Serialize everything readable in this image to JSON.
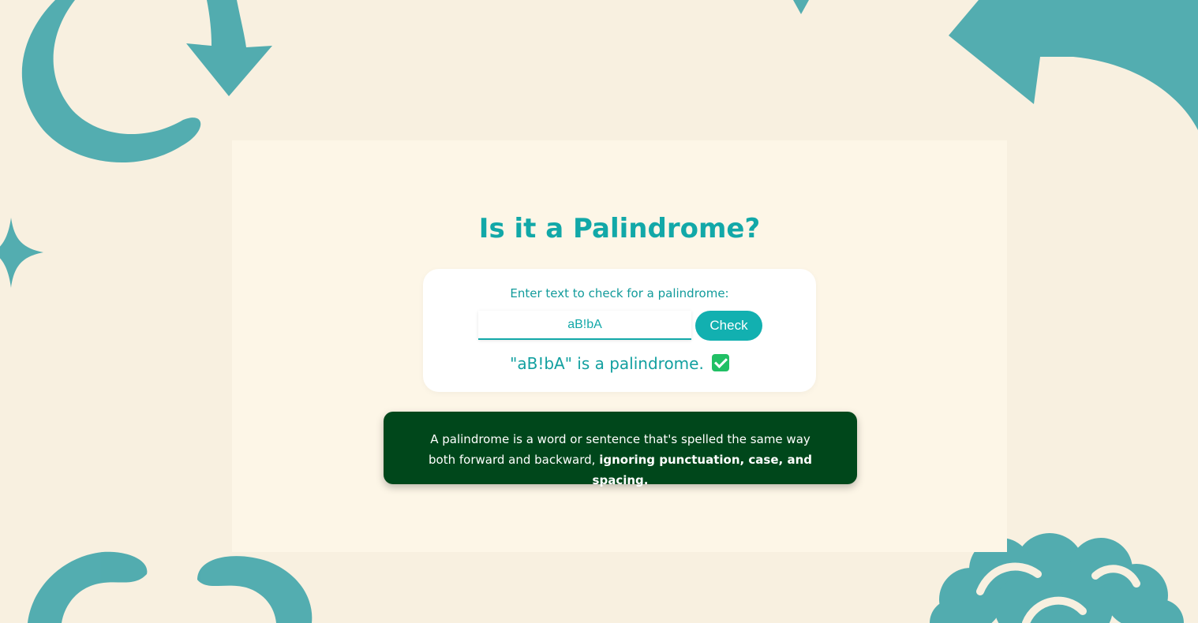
{
  "title": "Is it a Palindrome?",
  "input": {
    "label": "Enter text to check for a palindrome:",
    "value": "aB!bA"
  },
  "check_button": "Check",
  "result": {
    "text": "\"aB!bA\" is a palindrome.",
    "icon": "check-mark-icon"
  },
  "info": {
    "text": "A palindrome is a word or sentence that's spelled the same way both forward and backward, ",
    "emphasis": "ignoring punctuation, case, and spacing."
  },
  "colors": {
    "background": "#f8f0e0",
    "accent": "#12a8a8",
    "info_background": "#00471b",
    "decoration": "#4aa9ad"
  }
}
